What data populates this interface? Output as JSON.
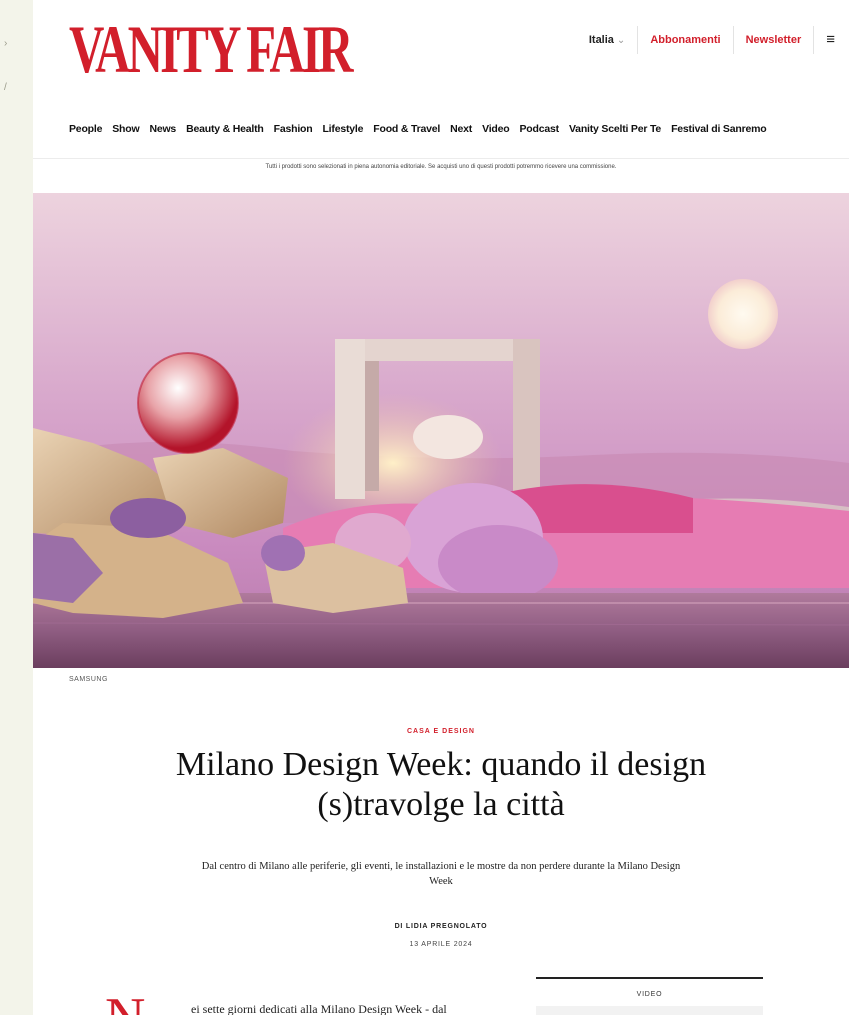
{
  "header": {
    "logo": "VANITY FAIR",
    "language": "Italia",
    "subscriptions": "Abbonamenti",
    "newsletter": "Newsletter",
    "menu_icon": "hamburger-menu-icon"
  },
  "nav": {
    "items": [
      "People",
      "Show",
      "News",
      "Beauty & Health",
      "Fashion",
      "Lifestyle",
      "Food & Travel",
      "Next",
      "Video",
      "Podcast",
      "Vanity Scelti Per Te",
      "Festival di Sanremo"
    ]
  },
  "disclaimer": "Tutti i prodotti sono selezionati in piena autonomia editoriale. Se acquisti uno di questi prodotti potremmo ricevere una commissione.",
  "hero": {
    "credit": "SAMSUNG"
  },
  "article": {
    "rubric": "CASA E DESIGN",
    "title": "Milano Design Week: quando il design (s)travolge la città",
    "dek": "Dal centro di Milano alle periferie, gli eventi, le installazioni e le mostre da non perdere durante la Milano Design Week",
    "byline": "DI LIDIA PREGNOLATO",
    "date": "13 APRILE 2024",
    "dropcap": "N",
    "body_first_line": "ei sette giorni dedicati alla Milano Design Week - dal"
  },
  "video": {
    "label": "VIDEO"
  },
  "colors": {
    "brand_red": "#d21f2b",
    "hero_sky_top": "#e9c7d9",
    "hero_sky_mid": "#c78ac0"
  }
}
